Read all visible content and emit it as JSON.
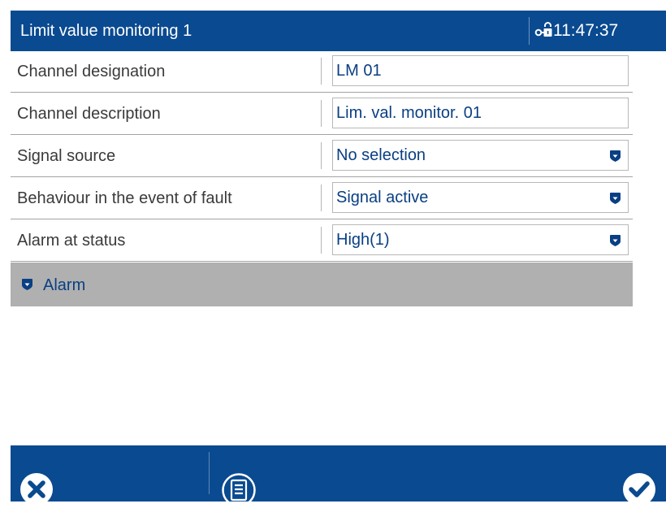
{
  "header": {
    "title": "Limit value monitoring 1",
    "time": "11:47:37",
    "icon": "lock-key-icon"
  },
  "rows": [
    {
      "label": "Channel designation",
      "value": "LM 01",
      "type": "text"
    },
    {
      "label": "Channel description",
      "value": "Lim. val. monitor. 01",
      "type": "text"
    },
    {
      "label": "Signal source",
      "value": "No selection",
      "type": "dropdown"
    },
    {
      "label": "Behaviour in the event of fault",
      "value": "Signal active",
      "type": "dropdown"
    },
    {
      "label": "Alarm at status",
      "value": "High(1)",
      "type": "dropdown"
    }
  ],
  "section": {
    "label": "Alarm",
    "icon": "expand-icon"
  },
  "footer": {
    "cancel_icon": "cancel-icon",
    "menu_icon": "document-list-icon",
    "ok_icon": "checkmark-icon"
  },
  "colors": {
    "header_bg": "#0a4a90",
    "value_text": "#0a3f83",
    "section_bg": "#b0b0b0"
  }
}
